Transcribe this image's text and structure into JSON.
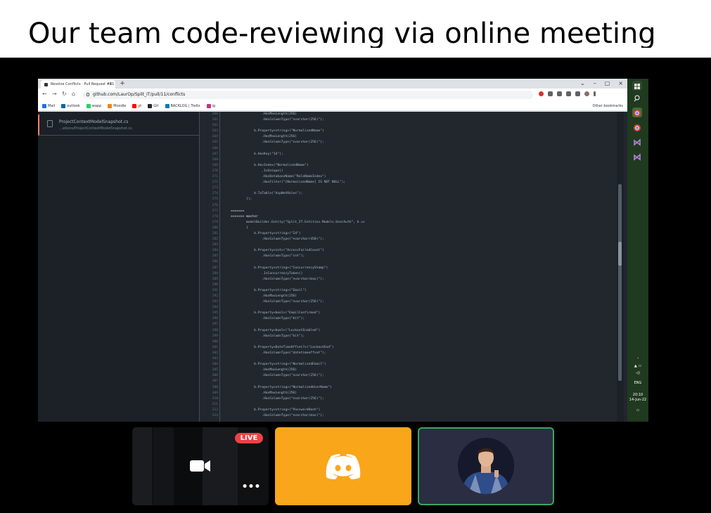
{
  "slide": {
    "title": "Our team code-reviewing via online meeting"
  },
  "browser": {
    "tab_title": "Resolve Conflicts · Pull Request #11",
    "tab_close": "×",
    "new_tab": "+",
    "window_controls": [
      "⌄",
      "–",
      "▢",
      "×"
    ],
    "url": "github.com/LaurOp/Split_IT/pull/11/conflicts",
    "bookmarks": [
      {
        "label": "Mail",
        "color": "#1a73e8"
      },
      {
        "label": "outlook",
        "color": "#0a64ad"
      },
      {
        "label": "wapp",
        "color": "#25d366"
      },
      {
        "label": "Moodle",
        "color": "#f98012"
      },
      {
        "label": "yt",
        "color": "#ff0000"
      },
      {
        "label": "Git",
        "color": "#24292f"
      },
      {
        "label": "BACKLOG | Trello",
        "color": "#0079bf"
      },
      {
        "label": "ig",
        "color": "#c13584"
      }
    ],
    "other_bookmarks": "Other bookmarks"
  },
  "editor": {
    "file_name": "ProjectContextModelSnapshot.cs",
    "file_path": "...ations/ProjectContextModelSnapshot.cs",
    "lines": [
      {
        "n": "260",
        "code": "                .HasMaxLength(256)"
      },
      {
        "n": "261",
        "code": "                .HasColumnType(\"nvarchar(256)\");"
      },
      {
        "n": "262",
        "code": ""
      },
      {
        "n": "263",
        "code": "            b.Property<string>(\"NormalizedName\")"
      },
      {
        "n": "264",
        "code": "                .HasMaxLength(256)"
      },
      {
        "n": "265",
        "code": "                .HasColumnType(\"nvarchar(256)\");"
      },
      {
        "n": "266",
        "code": ""
      },
      {
        "n": "267",
        "code": "            b.HasKey(\"Id\");"
      },
      {
        "n": "268",
        "code": ""
      },
      {
        "n": "269",
        "code": "            b.HasIndex(\"NormalizedName\")"
      },
      {
        "n": "270",
        "code": "                .IsUnique()"
      },
      {
        "n": "271",
        "code": "                .HasDatabaseName(\"RoleNameIndex\")"
      },
      {
        "n": "272",
        "code": "                .HasFilter(\"[NormalizedName] IS NOT NULL\");"
      },
      {
        "n": "273",
        "code": ""
      },
      {
        "n": "274",
        "code": "            b.ToTable(\"AspNetRoles\");"
      },
      {
        "n": "275",
        "code": "        });"
      },
      {
        "n": "276",
        "code": ""
      },
      {
        "n": "277",
        "code": "======="
      },
      {
        "n": "278",
        "code": ">>>>>>> master"
      },
      {
        "n": "279",
        "code": "        modelBuilder.Entity(\"Split_IT.Entities.Models.UserAuth\", b =>"
      },
      {
        "n": "280",
        "code": "        {"
      },
      {
        "n": "281",
        "code": "            b.Property<string>(\"Id\")"
      },
      {
        "n": "282",
        "code": "                .HasColumnType(\"nvarchar(450)\");"
      },
      {
        "n": "283",
        "code": ""
      },
      {
        "n": "284",
        "code": "            b.Property<int>(\"AccessFailedCount\")"
      },
      {
        "n": "285",
        "code": "                .HasColumnType(\"int\");"
      },
      {
        "n": "286",
        "code": ""
      },
      {
        "n": "287",
        "code": "            b.Property<string>(\"ConcurrencyStamp\")"
      },
      {
        "n": "288",
        "code": "                .IsConcurrencyToken()"
      },
      {
        "n": "289",
        "code": "                .HasColumnType(\"nvarchar(max)\");"
      },
      {
        "n": "290",
        "code": ""
      },
      {
        "n": "291",
        "code": "            b.Property<string>(\"Email\")"
      },
      {
        "n": "292",
        "code": "                .HasMaxLength(256)"
      },
      {
        "n": "293",
        "code": "                .HasColumnType(\"nvarchar(256)\");"
      },
      {
        "n": "294",
        "code": ""
      },
      {
        "n": "295",
        "code": "            b.Property<bool>(\"EmailConfirmed\")"
      },
      {
        "n": "296",
        "code": "                .HasColumnType(\"bit\");"
      },
      {
        "n": "297",
        "code": ""
      },
      {
        "n": "298",
        "code": "            b.Property<bool>(\"LockoutEnabled\")"
      },
      {
        "n": "299",
        "code": "                .HasColumnType(\"bit\");"
      },
      {
        "n": "300",
        "code": ""
      },
      {
        "n": "301",
        "code": "            b.Property<DateTimeOffset?>(\"LockoutEnd\")"
      },
      {
        "n": "302",
        "code": "                .HasColumnType(\"datetimeoffset\");"
      },
      {
        "n": "303",
        "code": ""
      },
      {
        "n": "304",
        "code": "            b.Property<string>(\"NormalizedEmail\")"
      },
      {
        "n": "305",
        "code": "                .HasMaxLength(256)"
      },
      {
        "n": "306",
        "code": "                .HasColumnType(\"nvarchar(256)\");"
      },
      {
        "n": "307",
        "code": ""
      },
      {
        "n": "308",
        "code": "            b.Property<string>(\"NormalizedUserName\")"
      },
      {
        "n": "309",
        "code": "                .HasMaxLength(256)"
      },
      {
        "n": "310",
        "code": "                .HasColumnType(\"nvarchar(256)\");"
      },
      {
        "n": "311",
        "code": ""
      },
      {
        "n": "312",
        "code": "            b.Property<string>(\"PasswordHash\")"
      },
      {
        "n": "313",
        "code": "                .HasColumnType(\"nvarchar(max)\");"
      }
    ]
  },
  "taskbar": {
    "lang": "ENG",
    "time": "20:10",
    "date": "14-Jun-22"
  },
  "participants": {
    "live_label": "LIVE",
    "more_label": "•••"
  },
  "colors": {
    "accent_green": "#3ba55c",
    "discord_tile": "#faa61a",
    "live_red": "#ed4245"
  }
}
